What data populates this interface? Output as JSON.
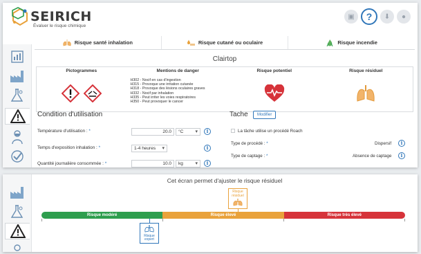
{
  "app": {
    "brand": "SEIRICH",
    "tagline": "Évaluer le risque chimique",
    "colors": {
      "accent": "#2f76b9",
      "green": "#2e9e4e",
      "orange": "#e9a23b",
      "red": "#d6333a"
    }
  },
  "header": {
    "tools": [
      {
        "icon": "briefcase-icon",
        "label": "▣"
      },
      {
        "icon": "help-icon",
        "label": "?"
      },
      {
        "icon": "download-icon",
        "label": "⬇"
      },
      {
        "icon": "user-icon",
        "label": "●"
      }
    ]
  },
  "tabs": [
    {
      "label": "Risque santé inhalation",
      "icon": "lungs-icon",
      "active": true
    },
    {
      "label": "Risque cutané ou oculaire",
      "icon": "skin-drop-icon",
      "active": false
    },
    {
      "label": "Risque incendie",
      "icon": "fire-icon",
      "active": false
    }
  ],
  "product": {
    "name": "Clairtop"
  },
  "table": {
    "headers": [
      "Pictogrammes",
      "Mentions de danger",
      "Risque potentiel",
      "Risque résiduel"
    ],
    "pictograms": [
      "exclamation-mark-icon",
      "corrosion-icon"
    ],
    "mentions": [
      "H302 - Nocif en cas d'ingestion",
      "H315 - Provoque une irritation cutanée",
      "H318 - Provoque des lésions oculaires graves",
      "H332 - Nocif par inhalation",
      "H335 - Peut irriter les voies respiratoires",
      "H350 - Peut provoquer le cancer"
    ]
  },
  "conditions": {
    "title": "Condition d'utilisation",
    "temperature": {
      "label": "Température d'utilisation :",
      "value": "20.0",
      "unit": "°C"
    },
    "exposure": {
      "label": "Temps d'exposition inhalation :",
      "value": "1-4 heures"
    },
    "quantity": {
      "label": "Quantité journalière consommée :",
      "value": "10.0",
      "unit": "kg"
    }
  },
  "tache": {
    "title": "Tache",
    "modify_label": "Modifier",
    "checkbox_label": "La tâche utilise un procédé Roach",
    "process_label": "Type de procédé :",
    "process_value": "Dispersif",
    "capture_label": "Type de captage :",
    "capture_value": "Absence de captage"
  },
  "adjust": {
    "title": "Cet écran permet d'ajuster le risque résiduel",
    "segments": [
      "Risque modéré",
      "Risque élevé",
      "Risque très élevé"
    ],
    "residual_marker": {
      "line1": "Risque",
      "line2": "résiduel"
    },
    "expert_marker": {
      "line1": "Risque",
      "line2": "expert"
    }
  },
  "nav": {
    "icons": [
      "chart-icon",
      "factory-icon",
      "flask-molecule-icon",
      "warning-triangle-icon",
      "person-mask-icon",
      "check-badge-icon"
    ],
    "active": "warning-triangle-icon"
  }
}
